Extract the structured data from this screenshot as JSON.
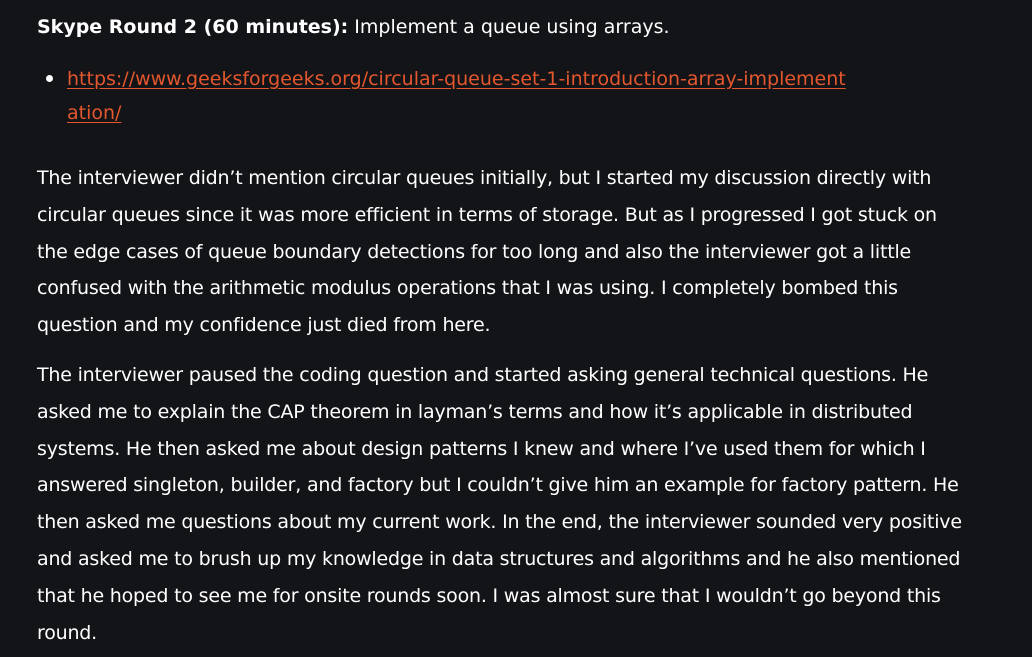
{
  "heading": {
    "bold": "Skype Round 2 (60 minutes):",
    "rest": " Implement a queue using arrays."
  },
  "links": [
    {
      "text": "https://www.geeksforgeeks.org/circular-queue-set-1-introduction-array-implementation/",
      "color": "#e4572e"
    }
  ],
  "paragraphs": [
    "The interviewer didn’t mention circular queues initially, but I started my discussion directly with circular queues since it was more efficient in terms of storage. But as I progressed I got stuck on the edge cases of queue boundary detections for too long and also the interviewer got a little confused with the arithmetic modulus operations that I was using. I completely bombed this question and my confidence just died from here.",
    "The interviewer paused the coding question and started asking general technical questions. He asked me to explain the CAP theorem in layman’s terms and how it’s applicable in distributed systems. He then asked me about design patterns I knew and where I’ve used them for which I answered singleton, builder, and factory but I couldn’t give him an example for factory pattern. He then asked me questions about my current work. In the end, the interviewer sounded very positive and asked me to brush up my knowledge in data structures and algorithms and he also mentioned that he hoped to see me for onsite rounds soon. I was almost sure that I wouldn’t go beyond this round."
  ],
  "colors": {
    "background": "#131417",
    "text": "#ffffff",
    "link": "#e4572e"
  }
}
